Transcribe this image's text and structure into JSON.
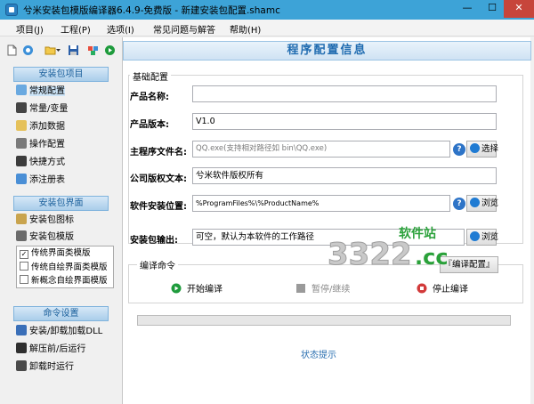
{
  "window": {
    "title": "兮米安装包模版编译器6.4.9-免费版 - 新建安装包配置.shamc",
    "min": "—",
    "max": "☐",
    "close": "✕"
  },
  "menu": [
    "项目(J)",
    "工程(P)",
    "选项(I)",
    "常见问题与解答",
    "帮助(H)"
  ],
  "sidebar": {
    "section1": {
      "header": "安装包项目",
      "items": [
        "常规配置",
        "常量/变量",
        "添加数据",
        "操作配置",
        "快捷方式",
        "添注册表"
      ]
    },
    "section2": {
      "header": "安装包界面",
      "items": [
        "安装包图标",
        "安装包模版"
      ],
      "templates": [
        {
          "label": "传统界面类模版",
          "checked": true
        },
        {
          "label": "传统自绘界面类模版",
          "checked": false
        },
        {
          "label": "新概念自绘界面模版",
          "checked": false
        }
      ]
    },
    "section3": {
      "header": "命令设置",
      "items": [
        "安装/卸载加载DLL",
        "解压前/后运行",
        "卸载时运行"
      ]
    }
  },
  "content": {
    "title": "程序配置信息",
    "basic_group": "基础配置",
    "fields": {
      "product_name_label": "产品名称:",
      "product_name_value": "",
      "product_version_label": "产品版本:",
      "product_version_value": "V1.0",
      "main_file_label": "主程序文件名:",
      "main_file_placeholder": "QQ.exe(支持相对路径如 bin\\QQ.exe)",
      "copyright_label": "公司版权文本:",
      "copyright_value": "兮米软件版权所有",
      "install_path_label": "软件安装位置:",
      "install_path_value": "%ProgramFiles%\\%ProductName%",
      "output_label": "安装包输出:",
      "output_value": "可空，默认为本软件的工作路径"
    },
    "buttons": {
      "choose": "选择",
      "browse1": "浏览",
      "browse2": "浏览",
      "help": "?"
    },
    "compile": {
      "group": "编译命令",
      "config_button": "『编译配置』",
      "start": "开始编译",
      "pause": "暂停/继续",
      "stop": "停止编译"
    },
    "status": "状态提示"
  },
  "watermark": {
    "line1": "软件站",
    "line2": "3322",
    "line3": ".cc"
  },
  "colors": {
    "titlebar": "#3da3d7",
    "accent": "#1f6bb0",
    "close": "#c7453b"
  }
}
